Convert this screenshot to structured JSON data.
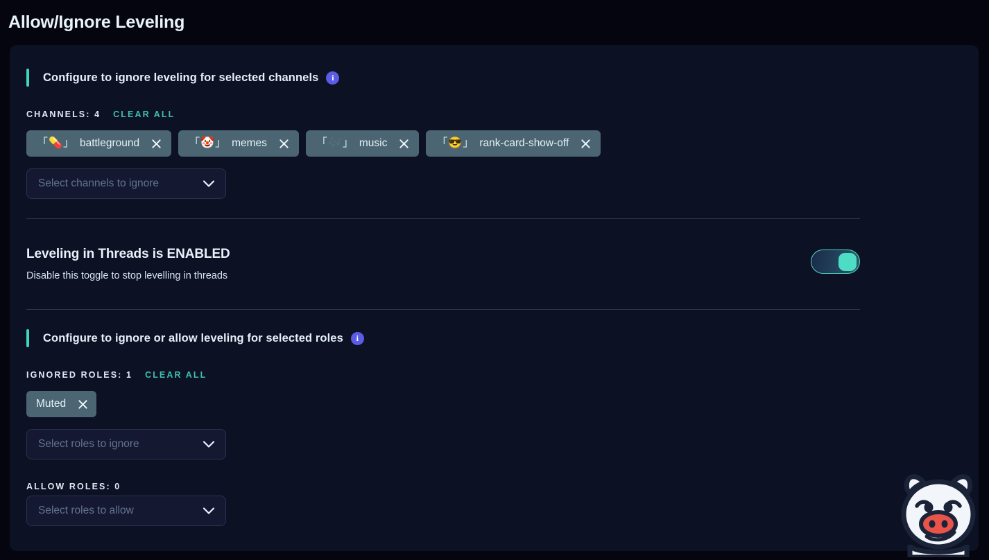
{
  "page": {
    "title": "Allow/Ignore Leveling"
  },
  "channels_section": {
    "title": "Configure to ignore leveling for selected channels",
    "info_icon": "info-icon",
    "info_glyph": "i",
    "count_label": "CHANNELS: 4",
    "clear_all_label": "CLEAR ALL",
    "chips": [
      {
        "bracket_open": "「",
        "emoji": "💊",
        "bracket_close": "」",
        "label": "battleground",
        "remove_icon": "close-icon"
      },
      {
        "bracket_open": "「",
        "emoji": "🤡",
        "bracket_close": "」",
        "label": "memes",
        "remove_icon": "close-icon"
      },
      {
        "bracket_open": "「",
        "emoji": "🎶",
        "bracket_close": "」",
        "label": "music",
        "remove_icon": "close-icon"
      },
      {
        "bracket_open": "「",
        "emoji": "😎",
        "bracket_close": "」",
        "label": "rank-card-show-off",
        "remove_icon": "close-icon"
      }
    ],
    "select": {
      "placeholder": "Select channels to ignore",
      "caret_icon": "chevron-down-icon"
    }
  },
  "threads_section": {
    "title": "Leveling in Threads is ENABLED",
    "subtitle": "Disable this toggle to stop levelling in threads",
    "toggle": {
      "name": "threads-leveling-toggle",
      "state": "on"
    }
  },
  "roles_section": {
    "title": "Configure to ignore or allow leveling for selected roles",
    "info_icon": "info-icon",
    "info_glyph": "i",
    "ignored_count_label": "IGNORED ROLES: 1",
    "clear_all_label": "CLEAR ALL",
    "ignored_chips": [
      {
        "label": "Muted",
        "remove_icon": "close-icon"
      }
    ],
    "ignore_select": {
      "placeholder": "Select roles to ignore",
      "caret_icon": "chevron-down-icon"
    },
    "allow_count_label": "ALLOW ROLES: 0",
    "allow_select": {
      "placeholder": "Select roles to allow",
      "caret_icon": "chevron-down-icon"
    }
  },
  "mascot": {
    "name": "pig-mascot",
    "colors": {
      "body": "#f2f6fa",
      "outline": "#1b2338",
      "snout": "#e8544a"
    }
  },
  "colors": {
    "page_background": "#050510",
    "card_background": "#0d1124",
    "accent_teal": "#3fd6c0",
    "info_purple": "#5a5ce6",
    "chip_background": "#4b6672",
    "text_primary": "#e9f3fb",
    "text_muted": "#64748e"
  }
}
